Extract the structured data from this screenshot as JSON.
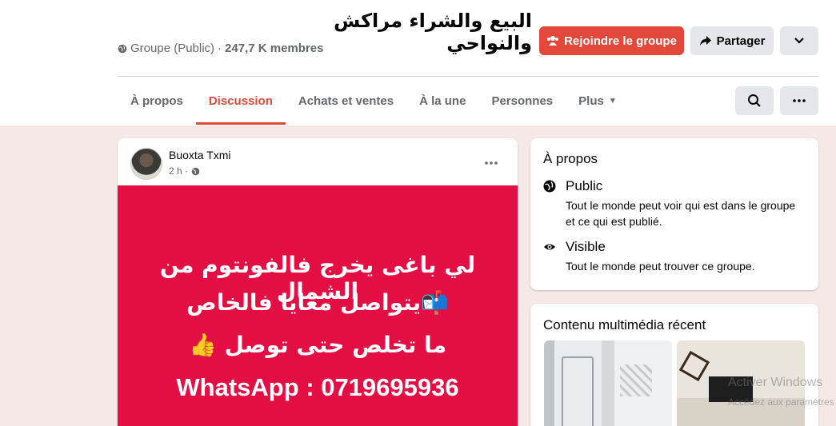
{
  "header": {
    "title": "البيع والشراء مراكش والنواحي",
    "privacy": "Groupe (Public)",
    "separator": "·",
    "members": "247,7 K membres",
    "join_label": "Rejoindre le groupe",
    "share_label": "Partager"
  },
  "tabs": [
    {
      "label": "À propos",
      "active": false
    },
    {
      "label": "Discussion",
      "active": true
    },
    {
      "label": "Achats et ventes",
      "active": false
    },
    {
      "label": "À la une",
      "active": false
    },
    {
      "label": "Personnes",
      "active": false
    },
    {
      "label": "Plus",
      "active": false
    }
  ],
  "post": {
    "author": "Buoxta Txmi",
    "time": "2 h ·",
    "lines": [
      "لي باغى يخرج فالفونتوم من الشمال",
      "📬يتواصل معايا فالخاص",
      "ما تخلص حتى توصل 👍",
      "WhatsApp : 0719695936"
    ],
    "image_color": "#e30e43"
  },
  "about": {
    "title": "À propos",
    "public_title": "Public",
    "public_desc": "Tout le monde peut voir qui est dans le groupe et ce qui est publié.",
    "visible_title": "Visible",
    "visible_desc": "Tout le monde peut trouver ce groupe."
  },
  "media": {
    "title": "Contenu multimédia récent"
  },
  "watermark": {
    "line1": "Activer Windows",
    "line2": "Accédez aux paramètres"
  },
  "colors": {
    "accent": "#e4483a",
    "background": "#f6e8e6"
  }
}
